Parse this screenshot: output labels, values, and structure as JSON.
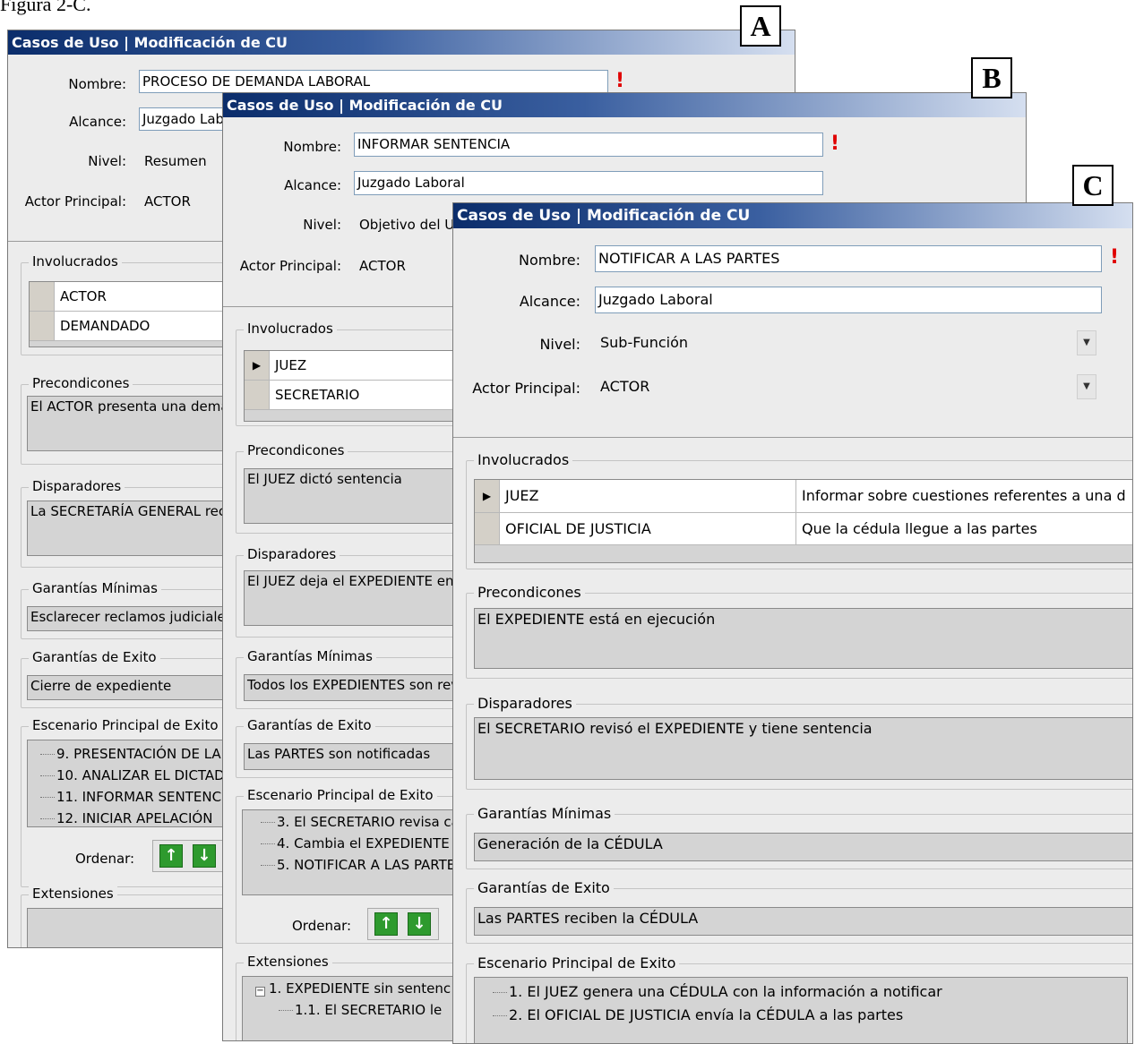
{
  "caption": "Figura 2-C.",
  "markers": {
    "a": "A",
    "b": "B",
    "c": "C"
  },
  "window_a": {
    "title": "Casos de Uso | Modificación de CU",
    "nombre_label": "Nombre:",
    "nombre_value": "PROCESO DE DEMANDA LABORAL",
    "alcance_label": "Alcance:",
    "alcance_value": "Juzgado Laboral",
    "nivel_label": "Nivel:",
    "nivel_value": "Resumen",
    "actor_label": "Actor Principal:",
    "actor_value": "ACTOR",
    "involucrados_title": "Involucrados",
    "involucrados": [
      "ACTOR",
      "DEMANDADO"
    ],
    "precondiciones_title": "Precondicones",
    "precondiciones": "El ACTOR presenta una demanda",
    "disparadores_title": "Disparadores",
    "disparadores": "La SECRETARÍA GENERAL recibe la demanda",
    "garantias_min_title": "Garantías Mínimas",
    "garantias_min": "Esclarecer reclamos judiciales",
    "garantias_exito_title": "Garantías de Exito",
    "garantias_exito": "Cierre de expediente",
    "escenario_title": "Escenario Principal de Exito",
    "escenario": [
      "9. PRESENTACIÓN DE LA",
      "10. ANALIZAR EL DICTAD",
      "11. INFORMAR SENTENC",
      "12. INICIAR APELACIÓN"
    ],
    "ordenar_label": "Ordenar:",
    "extensiones_title": "Extensiones"
  },
  "window_b": {
    "title": "Casos de Uso | Modificación de CU",
    "nombre_label": "Nombre:",
    "nombre_value": "INFORMAR SENTENCIA",
    "alcance_label": "Alcance:",
    "alcance_value": "Juzgado Laboral",
    "nivel_label": "Nivel:",
    "nivel_value": "Objetivo del Usuario",
    "actor_label": "Actor Principal:",
    "actor_value": "ACTOR",
    "involucrados_title": "Involucrados",
    "involucrados": [
      "JUEZ",
      "SECRETARIO"
    ],
    "precondiciones_title": "Precondicones",
    "precondiciones": "El JUEZ dictó sentencia",
    "disparadores_title": "Disparadores",
    "disparadores": "El JUEZ deja el EXPEDIENTE en",
    "garantias_min_title": "Garantías Mínimas",
    "garantias_min": "Todos los EXPEDIENTES son rev",
    "garantias_exito_title": "Garantías de Exito",
    "garantias_exito": "Las PARTES son notificadas",
    "escenario_title": "Escenario Principal de Exito",
    "escenario": [
      "3. El SECRETARIO revisa ca",
      "4. Cambia el EXPEDIENTE a",
      "5. NOTIFICAR A LAS PARTE"
    ],
    "ordenar_label": "Ordenar:",
    "extensiones_title": "Extensiones",
    "extensiones": [
      "1. EXPEDIENTE sin sentenc",
      "1.1. El SECRETARIO le"
    ]
  },
  "window_c": {
    "title": "Casos de Uso | Modificación de CU",
    "nombre_label": "Nombre:",
    "nombre_value": "NOTIFICAR A LAS PARTES",
    "alcance_label": "Alcance:",
    "alcance_value": "Juzgado Laboral",
    "nivel_label": "Nivel:",
    "nivel_value": "Sub-Función",
    "actor_label": "Actor Principal:",
    "actor_value": "ACTOR",
    "involucrados_title": "Involucrados",
    "involucrados": [
      {
        "actor": "JUEZ",
        "interes": "Informar sobre cuestiones referentes a una d"
      },
      {
        "actor": "OFICIAL DE JUSTICIA",
        "interes": "Que la cédula llegue a las partes"
      }
    ],
    "precondiciones_title": "Precondicones",
    "precondiciones": "El EXPEDIENTE está en ejecución",
    "disparadores_title": "Disparadores",
    "disparadores": "El SECRETARIO revisó el EXPEDIENTE y tiene sentencia",
    "garantias_min_title": "Garantías Mínimas",
    "garantias_min": "Generación de la CÉDULA",
    "garantias_exito_title": "Garantías de Exito",
    "garantias_exito": "Las PARTES reciben la CÉDULA",
    "escenario_title": "Escenario Principal de Exito",
    "escenario": [
      "1. El JUEZ genera una CÉDULA con la información a notificar",
      "2. El OFICIAL DE JUSTICIA envía la CÉDULA a las partes"
    ]
  },
  "colors": {
    "title_start": "#0b2d6b",
    "required": "#e00000",
    "arrow_green": "#2e9a2e"
  },
  "icons": {
    "required": "exclamation-icon",
    "row_selector": "triangle-right-icon",
    "up": "arrow-up-icon",
    "down": "arrow-down-icon",
    "dropdown": "chevron-down-icon",
    "collapse": "minus-box-icon"
  }
}
